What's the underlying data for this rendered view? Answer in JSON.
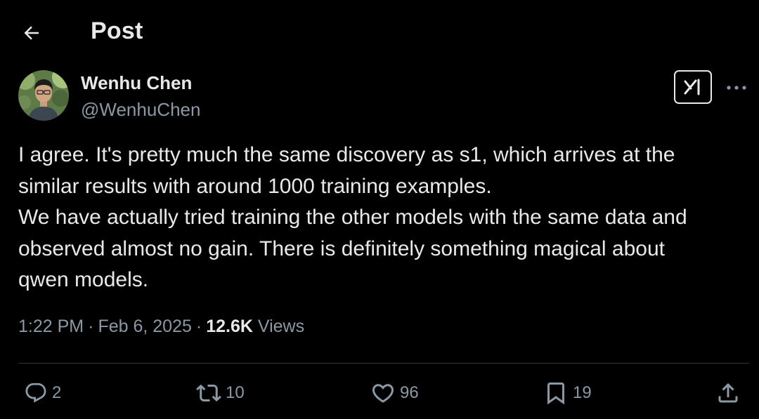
{
  "header": {
    "title": "Post"
  },
  "author": {
    "name": "Wenhu Chen",
    "handle": "@WenhuChen"
  },
  "post": {
    "lines": [
      "I agree. It's pretty much the same discovery as s1, which arrives at the",
      "similar results with around 1000 training examples.",
      "We have actually tried training the other models with the same data and",
      "observed almost no gain. There is definitely something magical about",
      "qwen models."
    ]
  },
  "meta": {
    "time": "1:22 PM",
    "date": "Feb 6, 2025",
    "separator": "·",
    "views_count": "12.6K",
    "views_label": "Views"
  },
  "actions": {
    "replies": "2",
    "reposts": "10",
    "likes": "96",
    "bookmarks": "19"
  },
  "colors": {
    "background": "#000000",
    "text_primary": "#e7e9ea",
    "text_secondary": "#8b98a5",
    "divider": "#2f3336"
  },
  "icons": {
    "back": "arrow-left-icon",
    "grok": "grok-icon",
    "more": "more-horizontal-icon",
    "reply": "reply-icon",
    "repost": "repost-icon",
    "like": "heart-icon",
    "bookmark": "bookmark-icon",
    "share": "share-icon"
  }
}
